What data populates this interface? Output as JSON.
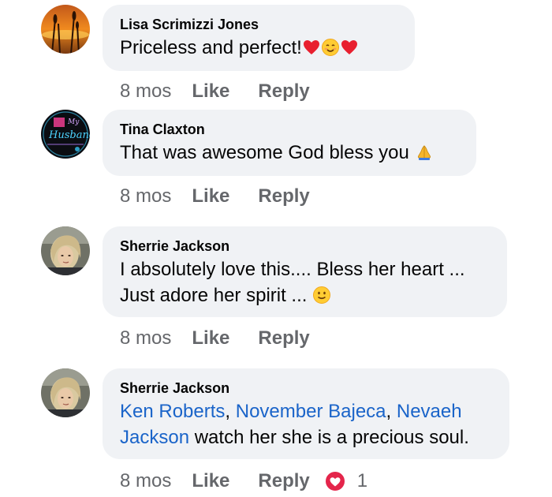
{
  "comments": [
    {
      "author": "Lisa Scrimizzi Jones",
      "text": "Priceless  and perfect!",
      "emojis": [
        "red-heart",
        "smiling-face-with-smiling-eyes",
        "red-heart"
      ],
      "time": "8 mos",
      "like": "Like",
      "reply": "Reply"
    },
    {
      "author": "Tina Claxton",
      "text": "That was awesome God bless you ",
      "emojis": [
        "folded-hands"
      ],
      "time": "8 mos",
      "like": "Like",
      "reply": "Reply"
    },
    {
      "author": "Sherrie Jackson",
      "line1": "I absolutely love this.... Bless her heart ...",
      "line2": "Just adore her spirit ... ",
      "emojis": [
        "slightly-smiling-face"
      ],
      "time": "8 mos",
      "like": "Like",
      "reply": "Reply"
    },
    {
      "author": "Sherrie Jackson",
      "mention1": "Ken Roberts",
      "sep1": ", ",
      "mention2": "November Bajeca",
      "sep2": ", ",
      "mention3": "Nevaeh",
      "mention3b": "Jackson",
      "text_after": " watch her she is a precious soul.",
      "time": "8 mos",
      "like": "Like",
      "reply": "Reply",
      "reaction_type": "love",
      "reaction_count": "1"
    }
  ],
  "colors": {
    "bubble_bg": "#f0f2f5",
    "meta_text": "#65676b",
    "mention": "#1a64c9",
    "love_reaction": "#e4254b"
  }
}
